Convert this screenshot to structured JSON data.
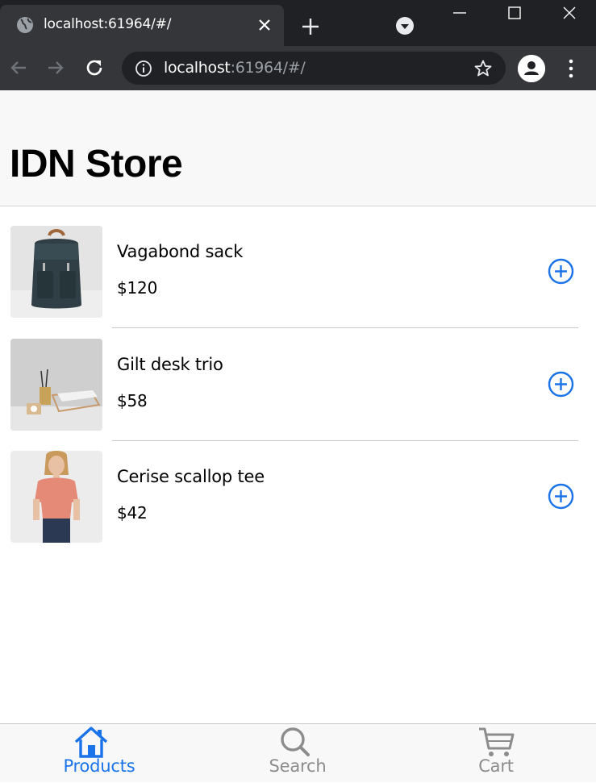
{
  "browser": {
    "tab_title": "localhost:61964/#/",
    "url_host": "localhost",
    "url_rest": ":61964/#/",
    "theme": "#35363a"
  },
  "app": {
    "title": "IDN Store",
    "accent": "#1a73e8"
  },
  "products": [
    {
      "name": "Vagabond sack",
      "price": "$120",
      "image": "backpack"
    },
    {
      "name": "Gilt desk trio",
      "price": "$58",
      "image": "desk-set"
    },
    {
      "name": "Cerise scallop tee",
      "price": "$42",
      "image": "pink-tee"
    }
  ],
  "tabbar": {
    "items": [
      {
        "label": "Products",
        "icon": "home-icon",
        "active": true
      },
      {
        "label": "Search",
        "icon": "search-icon",
        "active": false
      },
      {
        "label": "Cart",
        "icon": "cart-icon",
        "active": false
      }
    ],
    "active_color": "#1a73e8",
    "inactive_color": "#8c8c8c"
  }
}
